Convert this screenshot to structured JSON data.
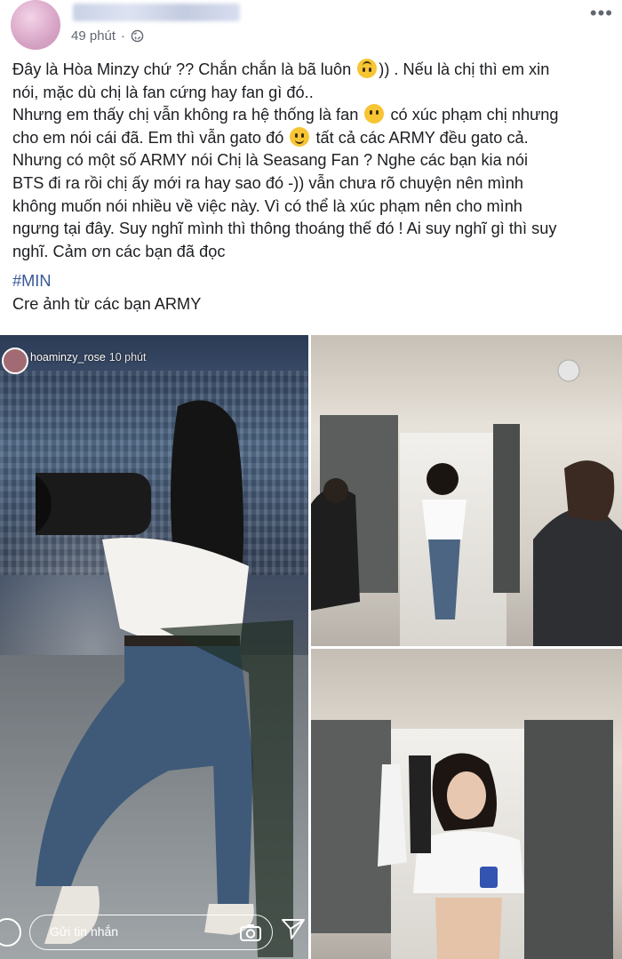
{
  "post": {
    "time": "49 phút",
    "privacy_icon": "globe-icon",
    "more_icon": "more-icon",
    "lines": {
      "l1a": "Đây là Hòa Minzy chứ ?? Chắn chắn là bã luôn",
      "l1b": ")) . Nếu là chị thì em xin",
      "l2": "nói, mặc dù chị là fan cứng hay fan gì đó..",
      "l3a": "Nhưng em thấy chị vẫn không ra hệ thống là fan",
      "l3b": "có xúc phạm chị nhưng",
      "l4a": "cho em nói cái đã. Em thì vẫn gato đó",
      "l4b": "tất cả các ARMY đều gato cả.",
      "l5": "Nhưng có một số ARMY nói Chị là Seasang Fan ? Nghe các bạn kia nói",
      "l6": "BTS đi ra rồi chị ấy mới ra hay sao đó -)) vẫn chưa rõ chuyện nên mình",
      "l7": "không muốn nói nhiều về việc này. Vì có thể là xúc phạm nên cho mình",
      "l8": "ngưng tại đây. Suy nghĩ mình thì thông thoáng thế đó ! Ai suy nghĩ gì thì suy",
      "l9": "nghĩ. Cảm ơn các bạn đã đọc"
    },
    "hashtag": "#MIN",
    "credit": "Cre ảnh từ các bạn ARMY"
  },
  "story": {
    "username": "hoaminzy_rose",
    "time": "10 phút",
    "message_placeholder": "Gửi tin nhắn"
  },
  "colors": {
    "hashtag": "#385898",
    "meta": "#606770"
  }
}
